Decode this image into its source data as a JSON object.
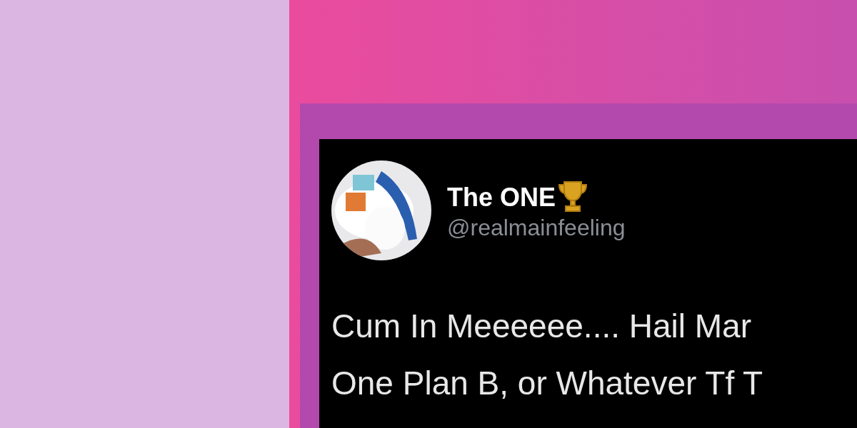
{
  "tweet": {
    "name": "The ONE",
    "handle": "@realmainfeeling",
    "lines": [
      "Cum In Meeeeee.... Hail Mar",
      "One Plan B, or Whatever Tf T"
    ]
  }
}
